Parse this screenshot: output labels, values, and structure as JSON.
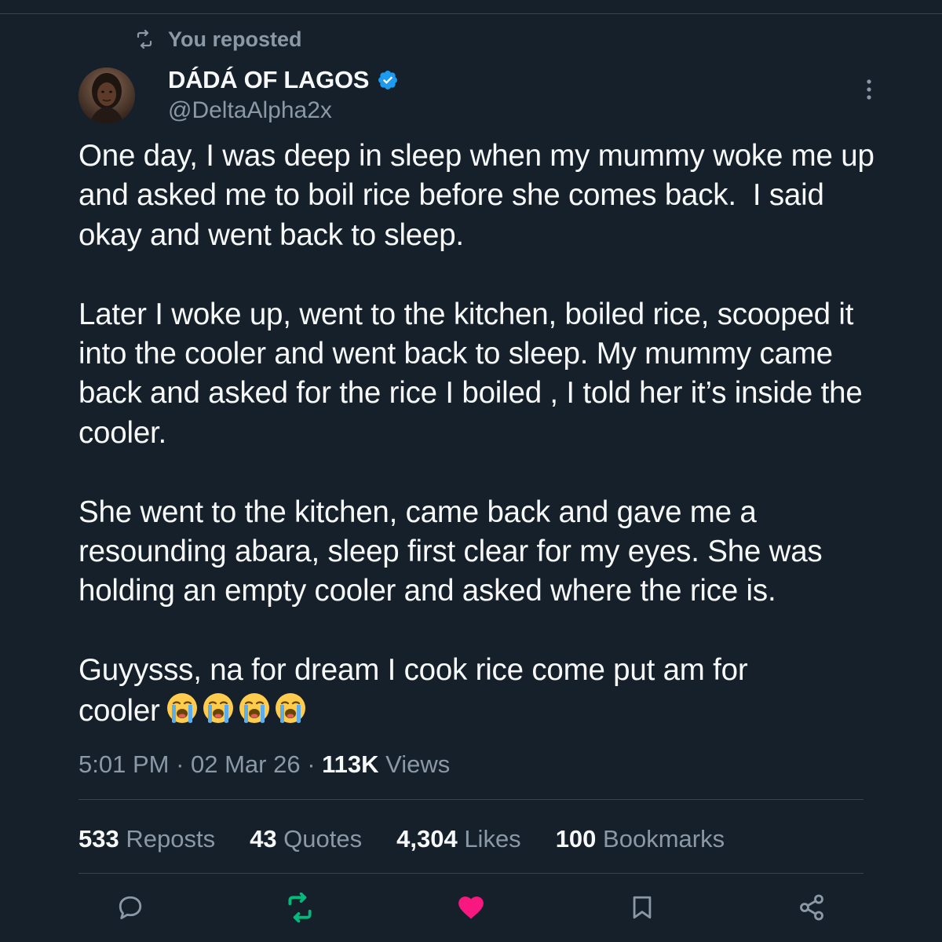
{
  "repost_context": {
    "label": "You reposted",
    "icon": "repost-icon"
  },
  "author": {
    "display_name": "DÁDÁ OF LAGOS",
    "handle": "@DeltaAlpha2x",
    "verified": true,
    "verified_color": "#1d9bf0"
  },
  "tweet": {
    "paragraphs": [
      "One day, I was deep in sleep when my mummy woke me up and asked me to boil rice before she comes back.  I said okay and went back to sleep.",
      "Later I woke up, went to the kitchen, boiled rice, scooped it into the cooler and went back to sleep. My mummy came back and asked for the rice I boiled , I told her it’s inside the cooler.",
      "She went to the kitchen, came back and gave me a resounding abara, sleep first clear for my eyes. She was holding an empty cooler and asked where the rice is.",
      "Guyysss, na for dream I cook rice come put am for cooler"
    ],
    "emoji": "loudly-crying-face-emoji",
    "emoji_count": 4
  },
  "meta": {
    "time": "5:01 PM",
    "separator": " · ",
    "date": "02 Mar 26",
    "views_count": "113K",
    "views_label": " Views"
  },
  "stats": [
    {
      "count": "533",
      "label": " Reposts"
    },
    {
      "count": "43",
      "label": " Quotes"
    },
    {
      "count": "4,304",
      "label": " Likes"
    },
    {
      "count": "100",
      "label": " Bookmarks"
    }
  ],
  "actions": [
    {
      "name": "reply",
      "icon": "reply-icon",
      "state": "default"
    },
    {
      "name": "repost",
      "icon": "repost-icon",
      "state": "active",
      "color": "#00ba7c"
    },
    {
      "name": "like",
      "icon": "heart-icon",
      "state": "active",
      "color": "#f91880"
    },
    {
      "name": "bookmark",
      "icon": "bookmark-icon",
      "state": "default"
    },
    {
      "name": "share",
      "icon": "share-icon",
      "state": "default"
    }
  ],
  "colors": {
    "background": "#15202b",
    "text_primary": "#f7f9f9",
    "text_secondary": "#8b98a5",
    "divider": "#38444d"
  }
}
